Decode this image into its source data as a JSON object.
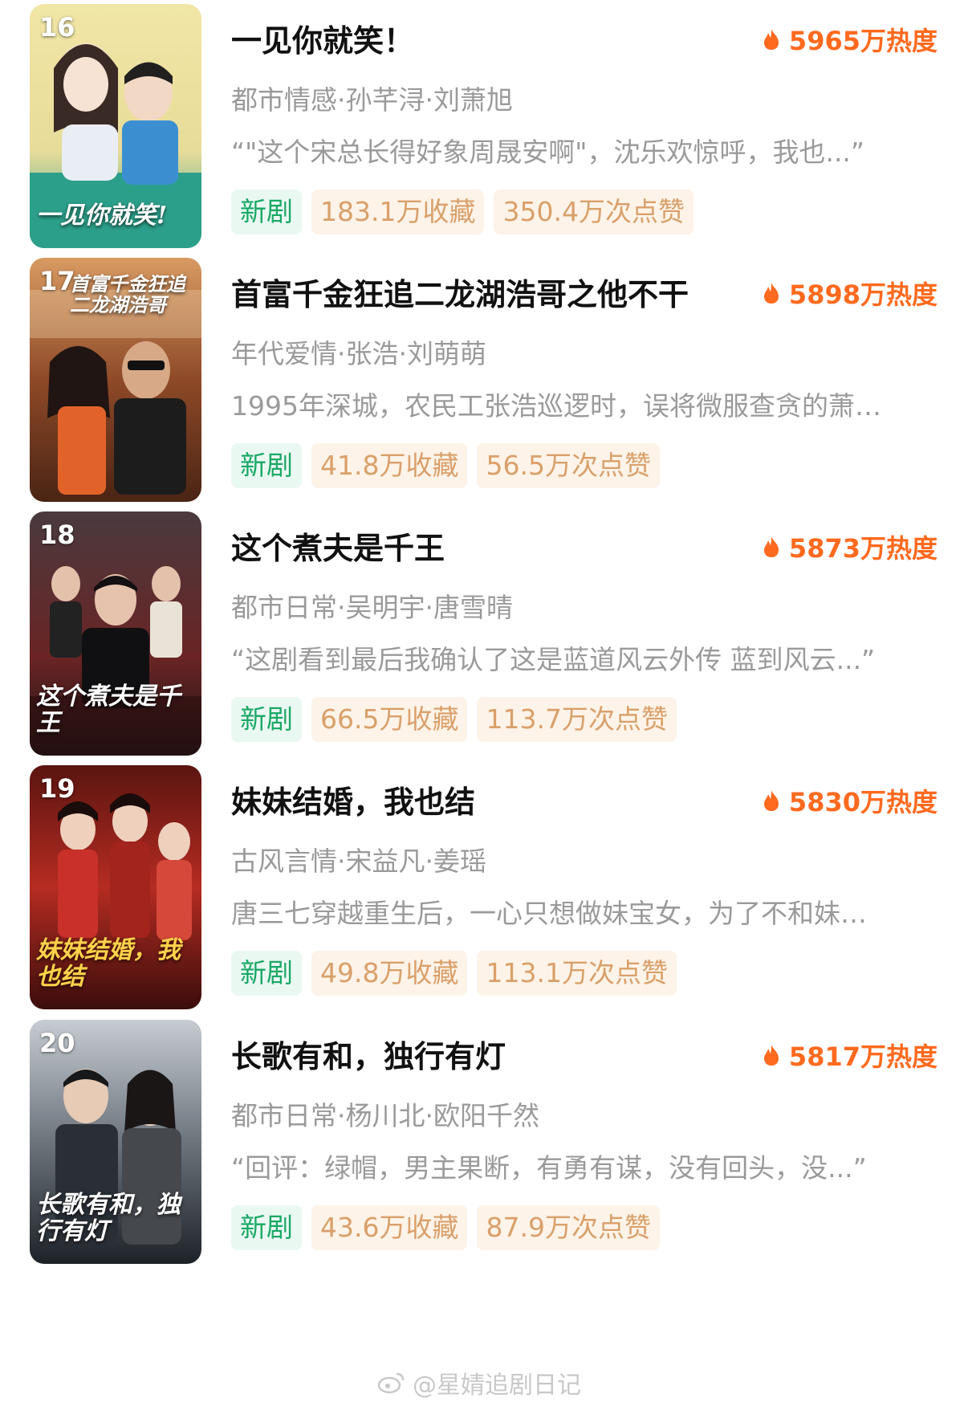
{
  "colors": {
    "heat": "#ff6a1f",
    "new_tag_bg": "#eaf8f2",
    "new_tag_text": "#19a866",
    "stat_tag_bg": "#fdf3e8",
    "stat_tag_text": "#d9a06a",
    "meta_text": "#9a9a9a"
  },
  "items": [
    {
      "rank": "16",
      "title": "一见你就笑！",
      "heat": "5965万热度",
      "meta": "都市情感·孙芊浔·刘萧旭",
      "desc": "“\"这个宋总长得好象周晟安啊\"，沈乐欢惊呼，我也...”",
      "tag_new": "新剧",
      "favorites": "183.1万收藏",
      "likes": "350.4万次点赞",
      "poster_text": "一见你就笑!",
      "poster_palette": [
        "#f1e6a6",
        "#7fc8b8",
        "#2c9f8a"
      ]
    },
    {
      "rank": "17",
      "title": "首富千金狂追二龙湖浩哥之他不干",
      "heat": "5898万热度",
      "meta": "年代爱情·张浩·刘萌萌",
      "desc": "1995年深城，农民工张浩巡逻时，误将微服查贪的萧…",
      "tag_new": "新剧",
      "favorites": "41.8万收藏",
      "likes": "56.5万次点赞",
      "poster_text": "首富千金狂追二龙湖浩哥",
      "poster_palette": [
        "#c9844e",
        "#6b3a22",
        "#e2632a"
      ]
    },
    {
      "rank": "18",
      "title": "这个煮夫是千王",
      "heat": "5873万热度",
      "meta": "都市日常·吴明宇·唐雪晴",
      "desc": "“这剧看到最后我确认了这是蓝道风云外传 蓝到风云...”",
      "tag_new": "新剧",
      "favorites": "66.5万收藏",
      "likes": "113.7万次点赞",
      "poster_text": "这个煮夫是千王",
      "poster_palette": [
        "#3a2a2e",
        "#8a2f2f",
        "#1b1416"
      ]
    },
    {
      "rank": "19",
      "title": "妹妹结婚，我也结",
      "heat": "5830万热度",
      "meta": "古风言情·宋益凡·姜瑶",
      "desc": "唐三七穿越重生后，一心只想做妹宝女，为了不和妹…",
      "tag_new": "新剧",
      "favorites": "49.8万收藏",
      "likes": "113.1万次点赞",
      "poster_text": "妹妹结婚，我也结",
      "poster_palette": [
        "#7a1a16",
        "#c33226",
        "#3a0d0b"
      ]
    },
    {
      "rank": "20",
      "title": "长歌有和，独行有灯",
      "heat": "5817万热度",
      "meta": "都市日常·杨川北·欧阳千然",
      "desc": "“回评：绿帽，男主果断，有勇有谋，没有回头，没...”",
      "tag_new": "新剧",
      "favorites": "43.6万收藏",
      "likes": "87.9万次点赞",
      "poster_text": "长歌有和，独行有灯",
      "poster_palette": [
        "#9aa3ab",
        "#3f4650",
        "#1d2228"
      ]
    }
  ],
  "watermark": "@星婧追剧日记"
}
